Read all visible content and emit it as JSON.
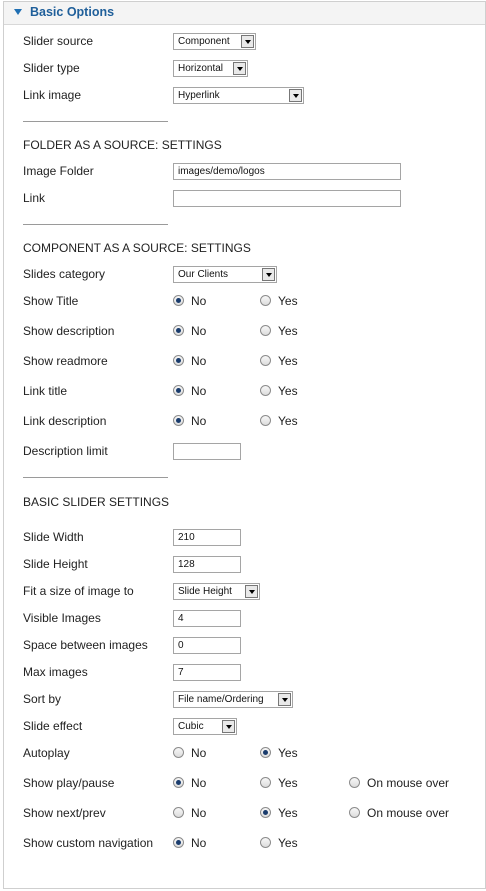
{
  "panel": {
    "title": "Basic Options"
  },
  "fields": {
    "slider_source": {
      "label": "Slider source",
      "value": "Component"
    },
    "slider_type": {
      "label": "Slider type",
      "value": "Horizontal"
    },
    "link_image": {
      "label": "Link image",
      "value": "Hyperlink"
    }
  },
  "folder_section": {
    "title": "FOLDER AS A SOURCE: SETTINGS",
    "image_folder": {
      "label": "Image Folder",
      "value": "images/demo/logos"
    },
    "link": {
      "label": "Link",
      "value": ""
    }
  },
  "component_section": {
    "title": "COMPONENT AS A SOURCE: SETTINGS",
    "slides_category": {
      "label": "Slides category",
      "value": "Our Clients"
    },
    "show_title": {
      "label": "Show Title",
      "selected": "No"
    },
    "show_description": {
      "label": "Show description",
      "selected": "No"
    },
    "show_readmore": {
      "label": "Show readmore",
      "selected": "No"
    },
    "link_title": {
      "label": "Link title",
      "selected": "No"
    },
    "link_description": {
      "label": "Link description",
      "selected": "No"
    },
    "description_limit": {
      "label": "Description limit",
      "value": ""
    }
  },
  "slider_section": {
    "title": "BASIC SLIDER SETTINGS",
    "slide_width": {
      "label": "Slide Width",
      "value": "210"
    },
    "slide_height": {
      "label": "Slide Height",
      "value": "128"
    },
    "fit_size": {
      "label": "Fit a size of image to",
      "value": "Slide Height"
    },
    "visible_images": {
      "label": "Visible Images",
      "value": "4"
    },
    "space_between": {
      "label": "Space between images",
      "value": "0"
    },
    "max_images": {
      "label": "Max images",
      "value": "7"
    },
    "sort_by": {
      "label": "Sort by",
      "value": "File name/Ordering"
    },
    "slide_effect": {
      "label": "Slide effect",
      "value": "Cubic"
    },
    "autoplay": {
      "label": "Autoplay",
      "selected": "Yes"
    },
    "show_play_pause": {
      "label": "Show play/pause",
      "selected": "No"
    },
    "show_next_prev": {
      "label": "Show next/prev",
      "selected": "Yes"
    },
    "show_custom_navigation": {
      "label": "Show custom navigation",
      "selected": "No"
    }
  },
  "options": {
    "no": "No",
    "yes": "Yes",
    "on_mouse_over": "On mouse over"
  }
}
